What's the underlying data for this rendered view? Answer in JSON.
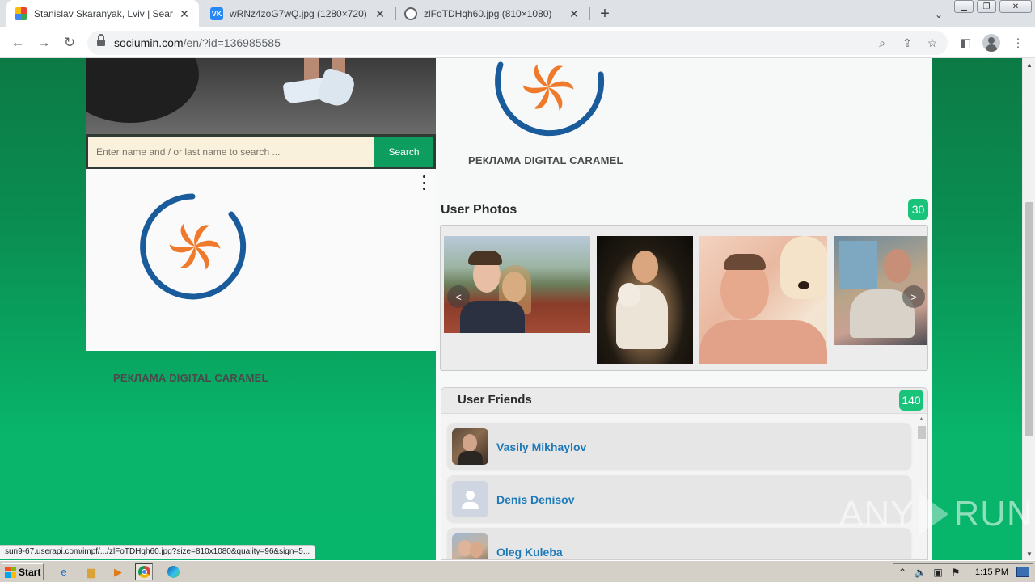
{
  "browser": {
    "tabs": [
      {
        "title": "Stanislav Skaranyak, Lviv | Search In",
        "favicon": "sociumin-favicon",
        "active": true
      },
      {
        "title": "wRNz4zoG7wQ.jpg (1280×720)",
        "favicon": "vk-favicon",
        "active": false
      },
      {
        "title": "zlFoTDHqh60.jpg (810×1080)",
        "favicon": "globe-favicon",
        "active": false
      }
    ],
    "url_host": "sociumin.com",
    "url_path": "/en/?id=136985585",
    "status_url": "sun9-67.userapi.com/impf/.../zlFoTDHqh60.jpg?size=810x1080&quality=96&sign=5..."
  },
  "search": {
    "placeholder": "Enter name and / or last name to search ...",
    "button_label": "Search"
  },
  "logo": {
    "caption": "РЕКЛАМА DIGITAL CARAMEL",
    "ring_color": "#1a5b9c",
    "petal_color": "#f07a2c"
  },
  "photos": {
    "heading": "User Photos",
    "count": "30",
    "prev_label": "<",
    "next_label": ">"
  },
  "friends": {
    "heading": "User Friends",
    "count": "140",
    "items": [
      {
        "name": "Vasily Mikhaylov"
      },
      {
        "name": "Denis Denisov"
      },
      {
        "name": "Oleg Kuleba"
      }
    ]
  },
  "watermark": {
    "left": "ANY",
    "right": "RUN"
  },
  "taskbar": {
    "start_label": "Start",
    "clock": "1:15 PM"
  },
  "colors": {
    "accent_green": "#0d9d5f",
    "badge_green": "#19c47a",
    "link_blue": "#1e7ab8"
  }
}
